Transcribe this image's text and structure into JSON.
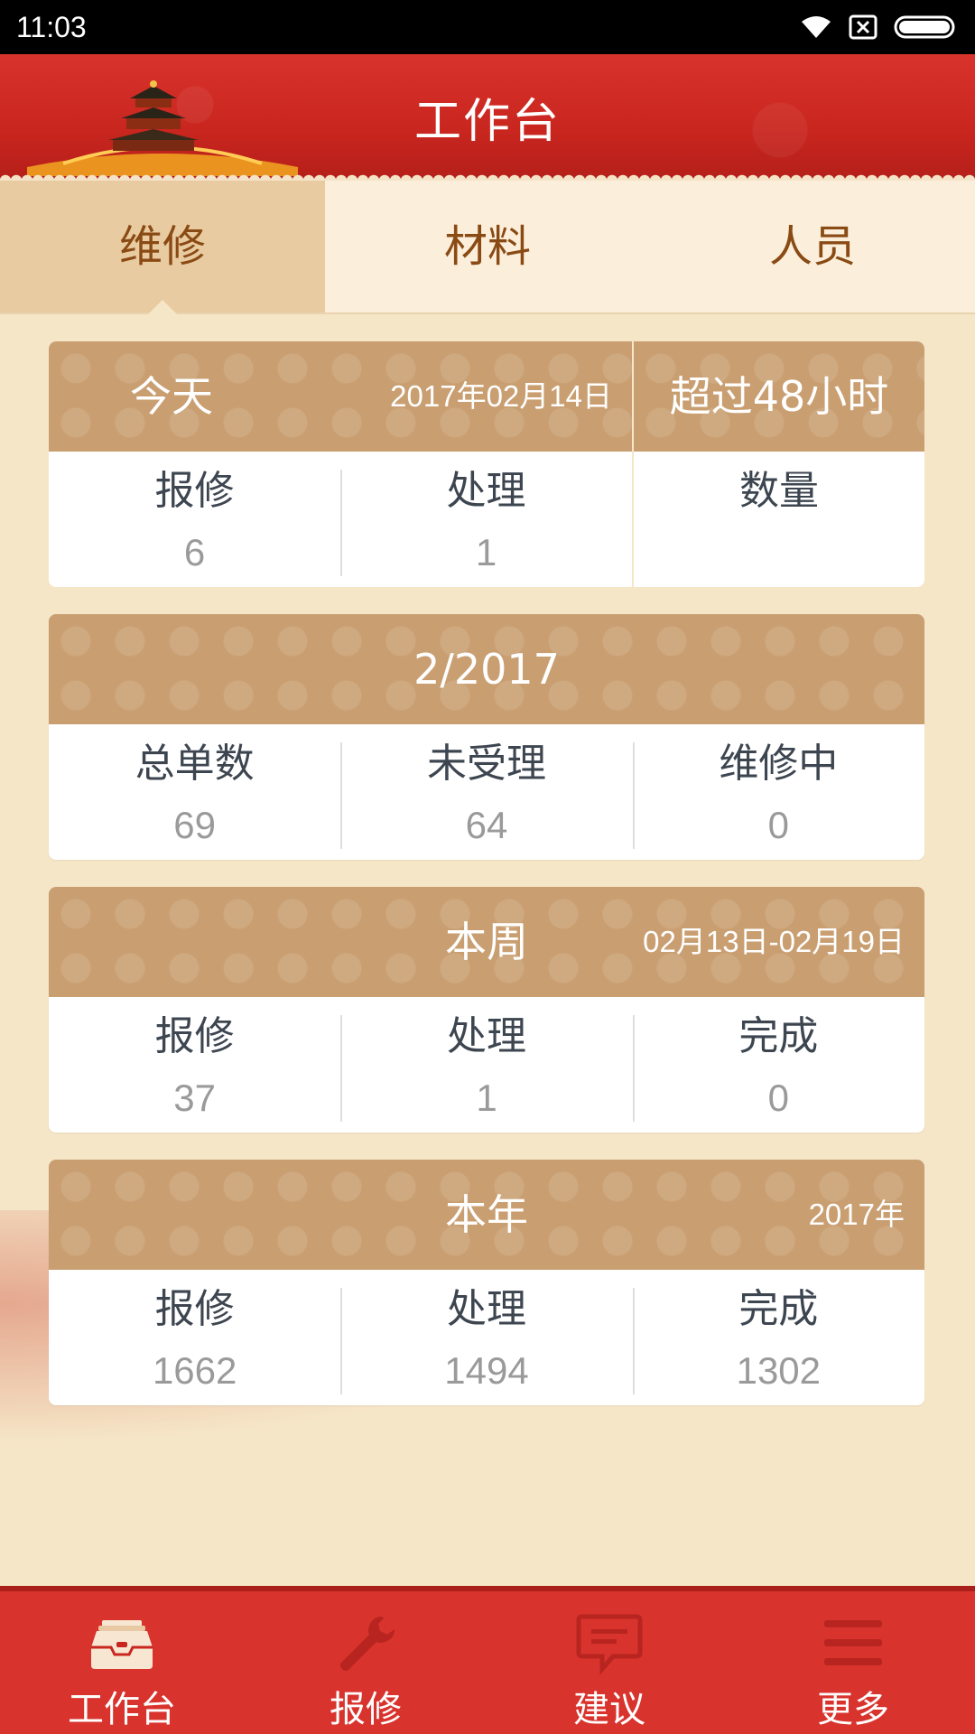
{
  "status_bar": {
    "time": "11:03"
  },
  "header": {
    "title": "工作台"
  },
  "tabs": [
    {
      "label": "维修",
      "active": true
    },
    {
      "label": "材料",
      "active": false
    },
    {
      "label": "人员",
      "active": false
    }
  ],
  "today_card": {
    "title": "今天",
    "date": "2017年02月14日",
    "cells": [
      {
        "label": "报修",
        "value": "6"
      },
      {
        "label": "处理",
        "value": "1"
      }
    ],
    "overdue": {
      "title": "超过48小时",
      "label": "数量",
      "value": ""
    }
  },
  "month_card": {
    "title": "2/2017",
    "cells": [
      {
        "label": "总单数",
        "value": "69"
      },
      {
        "label": "未受理",
        "value": "64"
      },
      {
        "label": "维修中",
        "value": "0"
      }
    ]
  },
  "week_card": {
    "title": "本周",
    "range": "02月13日-02月19日",
    "cells": [
      {
        "label": "报修",
        "value": "37"
      },
      {
        "label": "处理",
        "value": "1"
      },
      {
        "label": "完成",
        "value": "0"
      }
    ]
  },
  "year_card": {
    "title": "本年",
    "year": "2017年",
    "cells": [
      {
        "label": "报修",
        "value": "1662"
      },
      {
        "label": "处理",
        "value": "1494"
      },
      {
        "label": "完成",
        "value": "1302"
      }
    ]
  },
  "bottom_nav": [
    {
      "label": "工作台",
      "icon": "inbox-tray-icon",
      "active": true
    },
    {
      "label": "报修",
      "icon": "wrench-icon",
      "active": false
    },
    {
      "label": "建议",
      "icon": "chat-bubble-icon",
      "active": false
    },
    {
      "label": "更多",
      "icon": "menu-icon",
      "active": false
    }
  ],
  "colors": {
    "primary_red": "#d9332d",
    "card_header": "#c99f72",
    "tab_active_bg": "#e8cba0",
    "tab_text": "#8a4a14"
  }
}
